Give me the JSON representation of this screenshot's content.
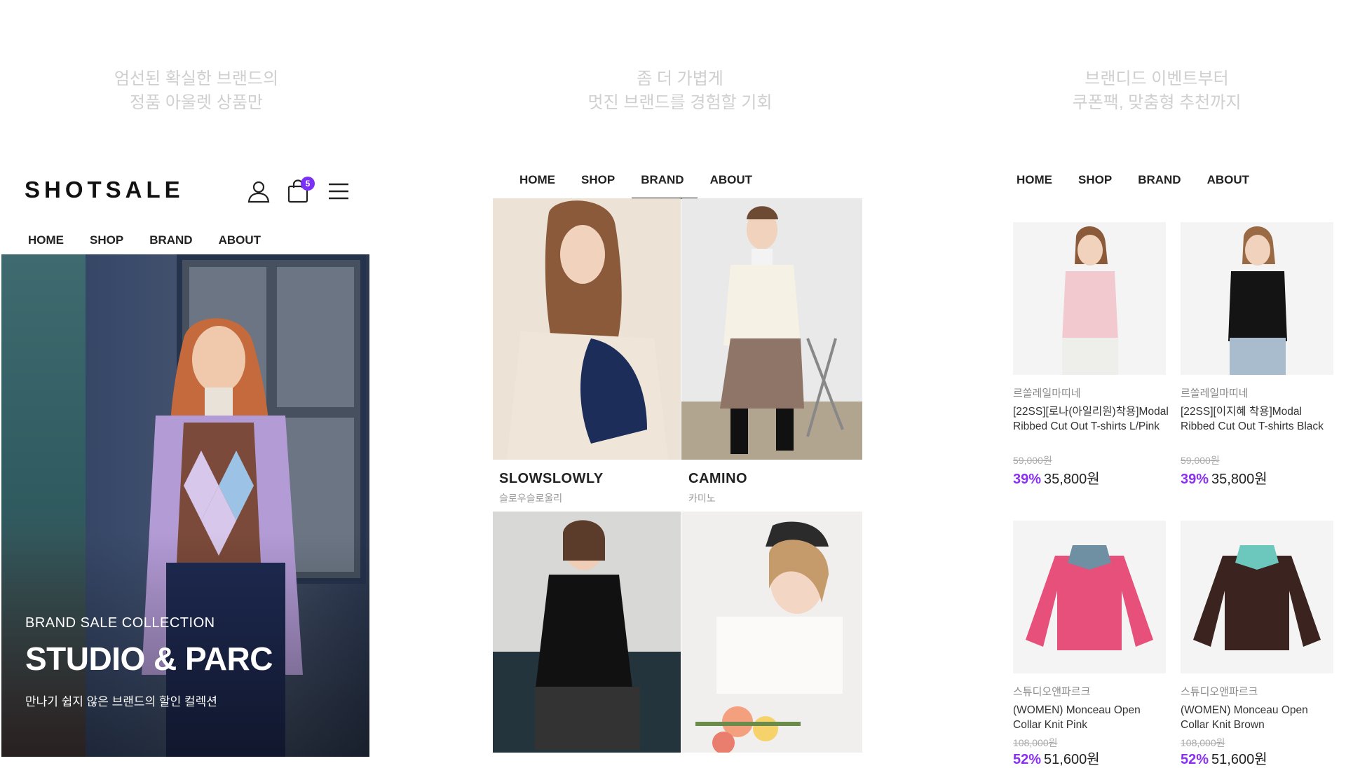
{
  "col1": {
    "tagline": [
      "엄선된 확실한 브랜드의",
      "정품 아울렛 상품만"
    ],
    "logo": "SHOTSALE",
    "cart_count": "5",
    "nav": [
      "HOME",
      "SHOP",
      "BRAND",
      "ABOUT"
    ],
    "hero": {
      "subtitle": "BRAND SALE COLLECTION",
      "title": "STUDIO & PARC",
      "desc": "만나기 쉽지 않은 브랜드의 할인 컬렉션"
    },
    "icons": [
      "user-icon",
      "shopping-bag-icon",
      "menu-icon"
    ]
  },
  "col2": {
    "tagline": [
      "좀 더 가볍게",
      "멋진 브랜드를 경험할 기회"
    ],
    "nav": [
      "HOME",
      "SHOP",
      "BRAND",
      "ABOUT"
    ],
    "active_nav": "BRAND",
    "brands": [
      {
        "name": "SLOWSLOWLY",
        "kor": "슬로우슬로울리"
      },
      {
        "name": "CAMINO",
        "kor": "카미노"
      }
    ]
  },
  "col3": {
    "tagline": [
      "브랜디드 이벤트부터",
      "쿠폰팩, 맞춤형 추천까지"
    ],
    "nav": [
      "HOME",
      "SHOP",
      "BRAND",
      "ABOUT"
    ],
    "products": [
      {
        "brand": "르쏠레일마띠네",
        "title": "[22SS][로나(아일리원)착용]Modal Ribbed Cut Out T-shirts L/Pink",
        "orig": "59,000원",
        "disc": "39%",
        "price": "35,800원"
      },
      {
        "brand": "르쏠레일마띠네",
        "title": "[22SS][이지혜 착용]Modal Ribbed Cut Out T-shirts Black",
        "orig": "59,000원",
        "disc": "39%",
        "price": "35,800원"
      },
      {
        "brand": "스튜디오앤파르크",
        "title": "(WOMEN) Monceau Open Collar Knit Pink",
        "orig": "108,000원",
        "disc": "52%",
        "price": "51,600원"
      },
      {
        "brand": "스튜디오앤파르크",
        "title": "(WOMEN) Monceau Open Collar Knit Brown",
        "orig": "108,000원",
        "disc": "52%",
        "price": "51,600원"
      }
    ]
  },
  "colors": {
    "accent": "#8b2ff2",
    "badge": "#7b2ff7"
  }
}
